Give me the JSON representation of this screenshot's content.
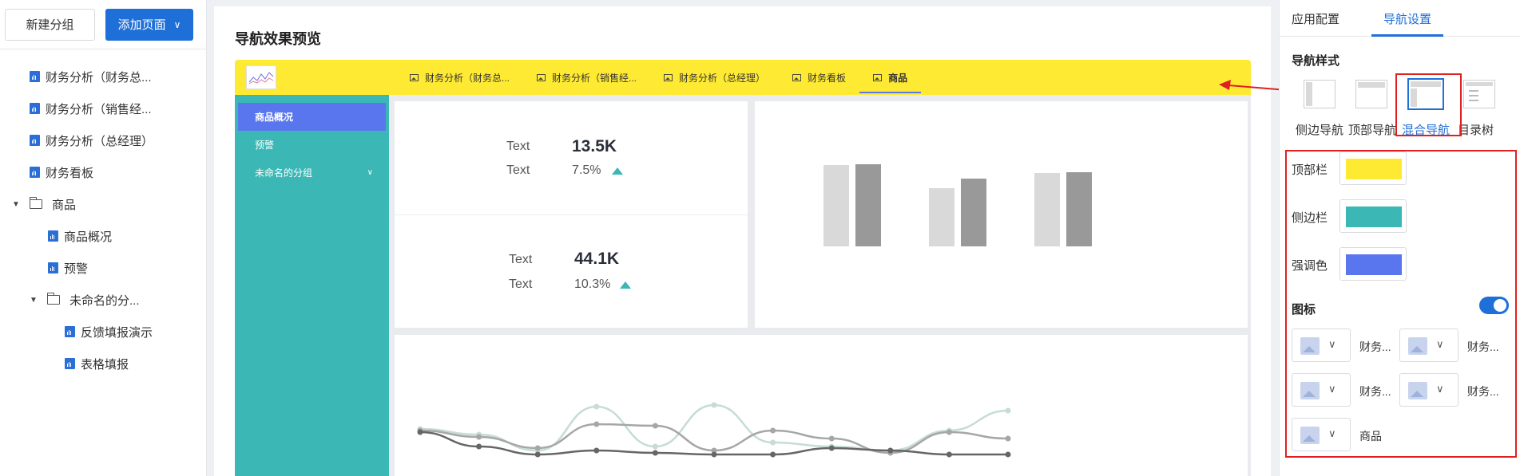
{
  "left_panel": {
    "new_group_label": "新建分组",
    "add_page_label": "添加页面",
    "tree": [
      {
        "label": "财务分析（财务总...",
        "type": "report",
        "level": 0
      },
      {
        "label": "财务分析（销售经...",
        "type": "report",
        "level": 0
      },
      {
        "label": "财务分析（总经理）",
        "type": "report",
        "level": 0
      },
      {
        "label": "财务看板",
        "type": "report",
        "level": 0
      },
      {
        "label": "商品",
        "type": "folder",
        "level": 0
      },
      {
        "label": "商品概况",
        "type": "report",
        "level": 1
      },
      {
        "label": "预警",
        "type": "report",
        "level": 1
      },
      {
        "label": "未命名的分...",
        "type": "folder",
        "level": 1
      },
      {
        "label": "反馈填报演示",
        "type": "report",
        "level": 2
      },
      {
        "label": "表格填报",
        "type": "report",
        "level": 2
      }
    ]
  },
  "preview": {
    "title": "导航效果预览",
    "tabs": [
      "财务分析（财务总...",
      "财务分析（销售经...",
      "财务分析（总经理）",
      "财务看板",
      "商品"
    ],
    "active_tab": "商品",
    "sidebar_items": [
      {
        "label": "商品概况",
        "active": true
      },
      {
        "label": "预警",
        "active": false
      },
      {
        "label": "未命名的分组",
        "active": false,
        "expandable": true
      }
    ],
    "kpis": [
      {
        "label1": "Text",
        "value": "13.5K",
        "label2": "Text",
        "pct": "7.5%"
      },
      {
        "label1": "Text",
        "value": "44.1K",
        "label2": "Text",
        "pct": "10.3%"
      }
    ]
  },
  "chart_data": [
    {
      "type": "bar",
      "categories": [
        "",
        "",
        ""
      ],
      "series": [
        {
          "values": [
            102,
            73,
            92
          ]
        },
        {
          "values": [
            103,
            85,
            93
          ]
        }
      ],
      "colors": [
        "#d9d9d9",
        "#999999"
      ]
    },
    {
      "type": "line",
      "x": [
        1,
        2,
        3,
        4,
        5,
        6,
        7,
        8,
        9,
        10,
        11
      ],
      "series": [
        {
          "values": [
            32,
            25,
            5,
            60,
            10,
            62,
            15,
            10,
            5,
            30,
            55
          ],
          "color": "#c6dcd5"
        },
        {
          "values": [
            30,
            22,
            8,
            38,
            36,
            5,
            30,
            20,
            2,
            28,
            20
          ],
          "color": "#a6a6a6"
        },
        {
          "values": [
            28,
            10,
            0,
            5,
            2,
            0,
            0,
            8,
            5,
            0,
            0
          ],
          "color": "#666666"
        }
      ]
    }
  ],
  "right_panel": {
    "tabs": [
      "应用配置",
      "导航设置"
    ],
    "active_tab": "导航设置",
    "nav_style_title": "导航样式",
    "styles": [
      "侧边导航",
      "顶部导航",
      "混合导航",
      "目录树"
    ],
    "active_style": "混合导航",
    "colors": [
      {
        "label": "顶部栏",
        "value": "#ffea33"
      },
      {
        "label": "侧边栏",
        "value": "#3bb7b5"
      },
      {
        "label": "强调色",
        "value": "#5a76ee"
      }
    ],
    "icon_title": "图标",
    "icon_toggle_on": true,
    "icon_items": [
      "财务...",
      "财务...",
      "财务...",
      "财务...",
      "商品"
    ]
  }
}
